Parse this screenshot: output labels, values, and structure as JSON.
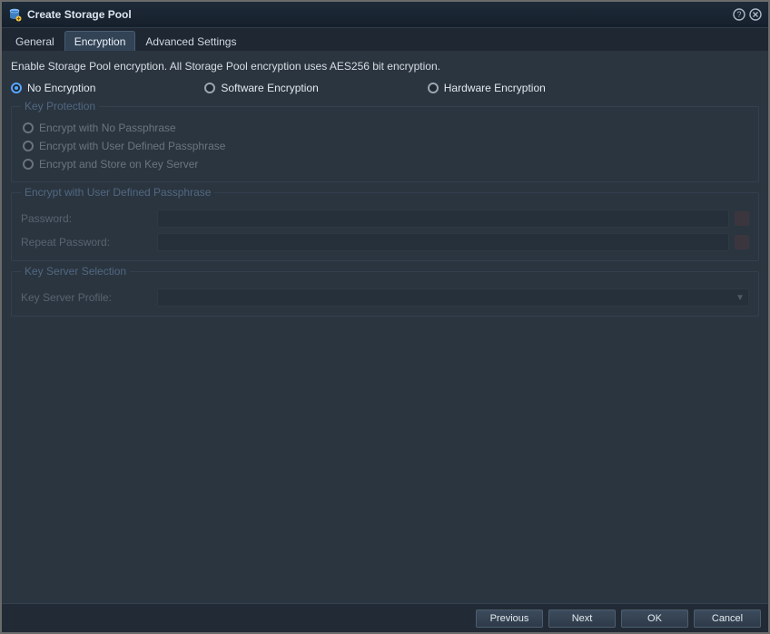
{
  "window": {
    "title": "Create Storage Pool"
  },
  "tabs": {
    "general": "General",
    "encryption": "Encryption",
    "advanced": "Advanced Settings"
  },
  "description": "Enable Storage Pool encryption. All Storage Pool encryption uses AES256 bit encryption.",
  "encryption_mode": {
    "none": "No Encryption",
    "software": "Software Encryption",
    "hardware": "Hardware Encryption"
  },
  "key_protection": {
    "legend": "Key Protection",
    "no_passphrase": "Encrypt with No Passphrase",
    "user_passphrase": "Encrypt with User Defined Passphrase",
    "key_server": "Encrypt and Store on Key Server"
  },
  "passphrase_section": {
    "legend": "Encrypt with User Defined Passphrase",
    "password_label": "Password:",
    "repeat_label": "Repeat Password:"
  },
  "key_server_section": {
    "legend": "Key Server Selection",
    "profile_label": "Key Server Profile:"
  },
  "footer": {
    "previous": "Previous",
    "next": "Next",
    "ok": "OK",
    "cancel": "Cancel"
  }
}
